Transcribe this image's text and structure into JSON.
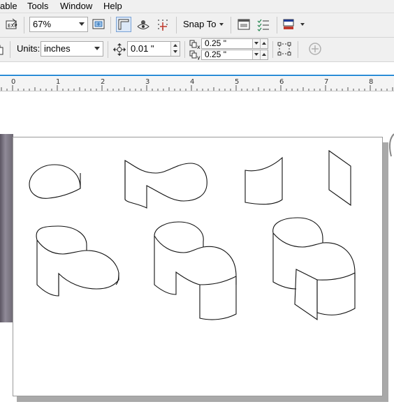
{
  "menu": {
    "items": [
      "able",
      "Tools",
      "Window",
      "Help"
    ]
  },
  "toolbar1": {
    "zoom_value": "67%",
    "snap_label": "Snap To",
    "icons": [
      "export-icon",
      "zoom-to-page-icon",
      "show-rulers-icon",
      "view-icon",
      "grid-snap-icon",
      "options-icon",
      "checklist-icon",
      "color-icon"
    ]
  },
  "toolbar2": {
    "units_label": "Units:",
    "units_value": "inches",
    "nudge_value": "0.01 \"",
    "dup_x_value": "0.25 \"",
    "dup_y_value": "0.25 \""
  },
  "ruler": {
    "numbers": [
      "0",
      "1",
      "2",
      "3",
      "4",
      "5",
      "6",
      "7",
      "8"
    ]
  },
  "colors": {
    "accent": "#2b8cd6",
    "toolbar_bg": "#f0f0f0",
    "page_shadow": "#a9a9a9"
  }
}
